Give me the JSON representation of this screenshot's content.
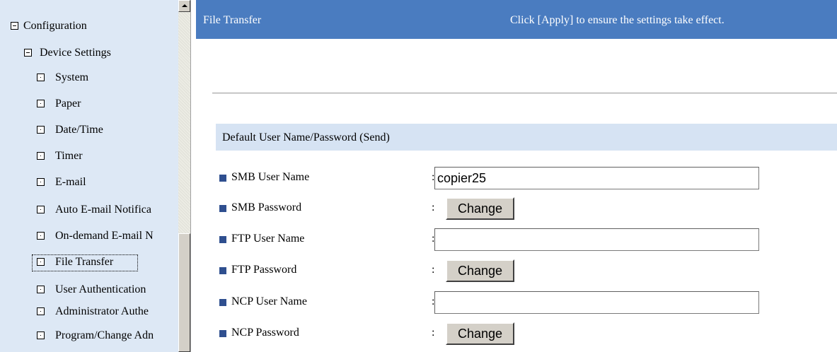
{
  "nav": {
    "items": [
      {
        "label": "Configuration",
        "box": "minus"
      },
      {
        "label": "Device Settings",
        "box": "minus"
      },
      {
        "label": "System",
        "box": "dot"
      },
      {
        "label": "Paper",
        "box": "dot"
      },
      {
        "label": "Date/Time",
        "box": "dot"
      },
      {
        "label": "Timer",
        "box": "dot"
      },
      {
        "label": "E-mail",
        "box": "dot"
      },
      {
        "label": "Auto E-mail Notifica",
        "box": "dot"
      },
      {
        "label": "On-demand E-mail N",
        "box": "dot"
      },
      {
        "label": "File Transfer",
        "box": "dot",
        "focused": true
      },
      {
        "label": "User Authentication",
        "box": "dot"
      },
      {
        "label": "Administrator Authe",
        "box": "dot"
      },
      {
        "label": "Program/Change Adn",
        "box": "dot"
      }
    ]
  },
  "header": {
    "title": "File Transfer",
    "hint": "Click [Apply] to ensure the settings take effect."
  },
  "section": {
    "title": "Default User Name/Password (Send)"
  },
  "form": {
    "colon": ":",
    "rows": [
      {
        "label": "SMB User Name",
        "type": "text",
        "value": "copier25"
      },
      {
        "label": "SMB Password",
        "type": "button",
        "button_label": "Change"
      },
      {
        "label": "FTP User Name",
        "type": "text",
        "value": ""
      },
      {
        "label": "FTP Password",
        "type": "button",
        "button_label": "Change"
      },
      {
        "label": "NCP User Name",
        "type": "text",
        "value": ""
      },
      {
        "label": "NCP Password",
        "type": "button",
        "button_label": "Change"
      }
    ]
  },
  "colors": {
    "header_bg": "#4a7cc0",
    "nav_bg": "#dde8f5",
    "section_bg": "#d6e3f3",
    "bullet": "#2f4f8f"
  },
  "icons": {
    "expanded": "minus-box-icon",
    "leaf": "dot-box-icon",
    "bullet": "square-bullet-icon"
  }
}
